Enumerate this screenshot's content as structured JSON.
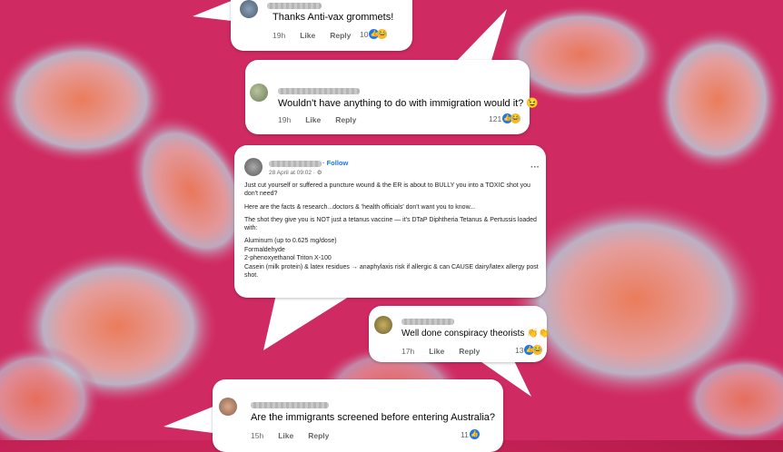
{
  "colors": {
    "background": "#c9245a",
    "like_blue": "#1877f2",
    "meta_gray": "#65676b"
  },
  "comments": [
    {
      "text": "Thanks Anti-vax grommets!",
      "time": "19h",
      "like": "Like",
      "reply": "Reply",
      "reactions": "10",
      "emoji": "😂"
    },
    {
      "text": "Wouldn't have anything to do with immigration would it? 😉",
      "time": "19h",
      "like": "Like",
      "reply": "Reply",
      "reactions": "121",
      "emoji": "😂"
    },
    {
      "text": "Well done conspiracy theorists 👏👏",
      "time": "17h",
      "like": "Like",
      "reply": "Reply",
      "reactions": "13",
      "emoji": "😂"
    },
    {
      "text": "Are the immigrants screened before entering Australia?",
      "time": "15h",
      "like": "Like",
      "reply": "Reply",
      "reactions": "11",
      "emoji": ""
    }
  ],
  "post": {
    "follow": "· Follow",
    "date": "28 April at 09:02 · ⚙",
    "more": "···",
    "paragraphs": [
      "Just cut yourself or suffered a puncture wound & the ER is about to BULLY you into a TOXIC shot you don't need?",
      "Here are the facts & research...doctors & 'health officials' don't want you to know...",
      "The shot they give you is NOT just a tetanus vaccine — it's DTaP Diphtheria Tetanus & Pertussis loaded with:"
    ],
    "list": [
      "Aluminum (up to 0.625 mg/dose)",
      "Formaldehyde",
      "2-phenoxyethanol Triton X-100",
      "Casein (milk protein) & latex residues → anaphylaxis risk if allergic & can CAUSE dairy/latex allergy post shot."
    ]
  }
}
